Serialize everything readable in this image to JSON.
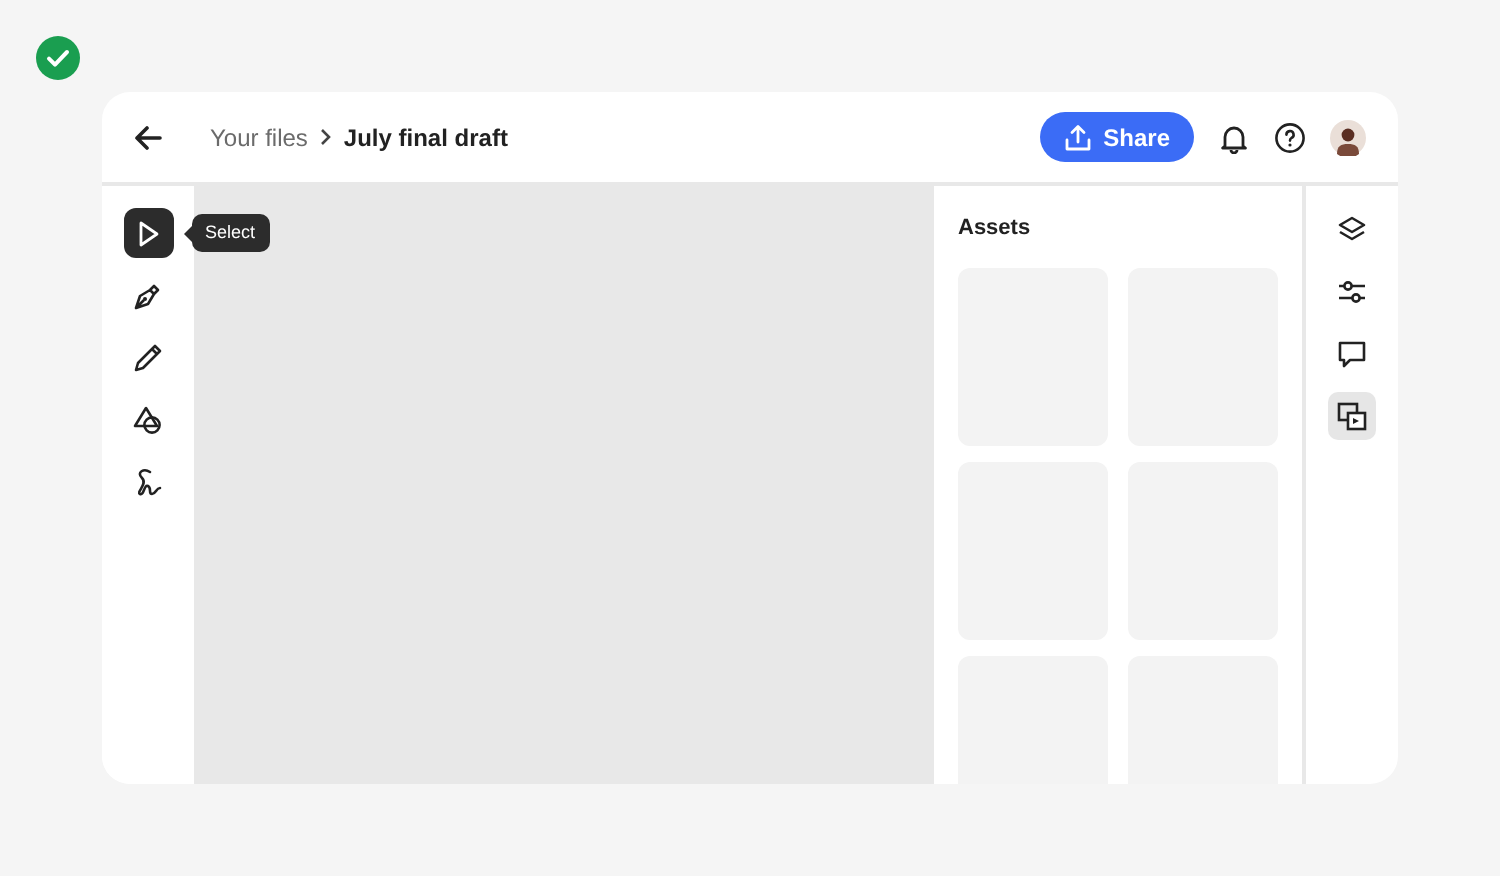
{
  "status": {
    "kind": "success"
  },
  "header": {
    "breadcrumb": [
      {
        "label": "Your files",
        "current": false
      },
      {
        "label": "July final draft",
        "current": true
      }
    ],
    "share_button": "Share"
  },
  "tools": [
    {
      "kind": "select",
      "selected": true,
      "tooltip": "Select"
    },
    {
      "kind": "pen",
      "selected": false
    },
    {
      "kind": "pencil",
      "selected": false
    },
    {
      "kind": "shapes",
      "selected": false
    },
    {
      "kind": "scribble",
      "selected": false
    }
  ],
  "assets": {
    "title": "Assets",
    "tiles": [
      {
        "kind": "placeholder"
      },
      {
        "kind": "placeholder"
      },
      {
        "kind": "placeholder"
      },
      {
        "kind": "placeholder"
      },
      {
        "kind": "placeholder"
      },
      {
        "kind": "placeholder"
      }
    ]
  },
  "right_rail": [
    {
      "kind": "layers",
      "selected": false
    },
    {
      "kind": "adjust",
      "selected": false
    },
    {
      "kind": "comments",
      "selected": false
    },
    {
      "kind": "assets",
      "selected": true
    }
  ]
}
